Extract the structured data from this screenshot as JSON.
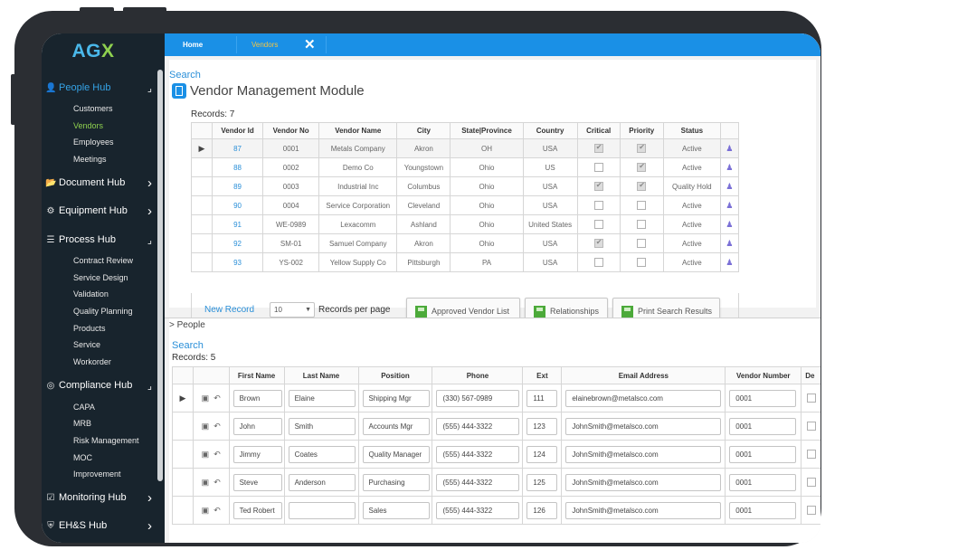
{
  "logo": {
    "a": "AG",
    "x": "X"
  },
  "sidebar": {
    "hubs": [
      {
        "label": "People Hub",
        "icon": "person-icon",
        "glyph": "👤",
        "arrow": "⌟",
        "active": true,
        "items": [
          "Customers",
          "Vendors",
          "Employees",
          "Meetings"
        ]
      },
      {
        "label": "Document Hub",
        "icon": "folder-icon",
        "glyph": "📂",
        "arrow": "›"
      },
      {
        "label": "Equipment Hub",
        "icon": "gears-icon",
        "glyph": "⚙",
        "arrow": "›"
      },
      {
        "label": "Process Hub",
        "icon": "list-icon",
        "glyph": "☰",
        "arrow": "⌟",
        "items": [
          "Contract Review",
          "Service Design",
          "Validation",
          "Quality Planning",
          "Products",
          "Service",
          "Workorder"
        ]
      },
      {
        "label": "Compliance Hub",
        "icon": "target-icon",
        "glyph": "◎",
        "arrow": "⌟",
        "items": [
          "CAPA",
          "MRB",
          "Risk Management",
          "MOC",
          "Improvement"
        ]
      },
      {
        "label": "Monitoring Hub",
        "icon": "checkbox-icon",
        "glyph": "☑",
        "arrow": "›"
      },
      {
        "label": "EH&S Hub",
        "icon": "shield-plus-icon",
        "glyph": "⛨",
        "arrow": "›"
      }
    ],
    "active_item": "Vendors"
  },
  "topbar": {
    "tabs": [
      "Home",
      "Vendors"
    ],
    "close_glyph": "✕"
  },
  "vendor": {
    "search_label": "Search",
    "title": "Vendor Management Module",
    "records": "Records:  7",
    "columns": [
      "Vendor Id",
      "Vendor No",
      "Vendor Name",
      "City",
      "State|Province",
      "Country",
      "Critical",
      "Priority",
      "Status"
    ],
    "rows": [
      {
        "id": "87",
        "no": "0001",
        "name": "Metals Company",
        "city": "Akron",
        "state": "OH",
        "country": "USA",
        "critical": true,
        "priority": true,
        "status": "Active"
      },
      {
        "id": "88",
        "no": "0002",
        "name": "Demo Co",
        "city": "Youngstown",
        "state": "Ohio",
        "country": "US",
        "critical": false,
        "priority": true,
        "status": "Active"
      },
      {
        "id": "89",
        "no": "0003",
        "name": "Industrial Inc",
        "city": "Columbus",
        "state": "Ohio",
        "country": "USA",
        "critical": true,
        "priority": true,
        "status": "Quality Hold"
      },
      {
        "id": "90",
        "no": "0004",
        "name": "Service Corporation",
        "city": "Cleveland",
        "state": "Ohio",
        "country": "USA",
        "critical": false,
        "priority": false,
        "status": "Active"
      },
      {
        "id": "91",
        "no": "WE-0989",
        "name": "Lexacomm",
        "city": "Ashland",
        "state": "Ohio",
        "country": "United States",
        "critical": false,
        "priority": false,
        "status": "Active"
      },
      {
        "id": "92",
        "no": "SM-01",
        "name": "Samuel Company",
        "city": "Akron",
        "state": "Ohio",
        "country": "USA",
        "critical": true,
        "priority": false,
        "status": "Active"
      },
      {
        "id": "93",
        "no": "YS-002",
        "name": "Yellow Supply Co",
        "city": "Pittsburgh",
        "state": "PA",
        "country": "USA",
        "critical": false,
        "priority": false,
        "status": "Active"
      }
    ],
    "new_record": "New Record",
    "per_page_value": "10",
    "per_page_label": "Records per page",
    "buttons": [
      "Approved Vendor List",
      "Relationships",
      "Print Search Results"
    ]
  },
  "people": {
    "section_label": "> People",
    "search_label": "Search",
    "records": "Records:  5",
    "columns": [
      "First Name",
      "Last Name",
      "Position",
      "Phone",
      "Ext",
      "Email Address",
      "Vendor Number",
      "De"
    ],
    "rows": [
      {
        "first": "Brown",
        "last": "Elaine",
        "position": "Shipping Mgr",
        "phone": "(330) 567-0989",
        "ext": "111",
        "email": "elainebrown@metalsco.com",
        "vendor": "0001"
      },
      {
        "first": "John",
        "last": "Smith",
        "position": "Accounts Mgr",
        "phone": "(555) 444-3322",
        "ext": "123",
        "email": "JohnSmith@metalsco.com",
        "vendor": "0001"
      },
      {
        "first": "Jimmy",
        "last": "Coates",
        "position": "Quality Manager",
        "phone": "(555) 444-3322",
        "ext": "124",
        "email": "JohnSmith@metalsco.com",
        "vendor": "0001"
      },
      {
        "first": "Steve",
        "last": "Anderson",
        "position": "Purchasing",
        "phone": "(555) 444-3322",
        "ext": "125",
        "email": "JohnSmith@metalsco.com",
        "vendor": "0001"
      },
      {
        "first": "Ted Robert",
        "last": "",
        "position": "Sales",
        "phone": "(555) 444-3322",
        "ext": "126",
        "email": "JohnSmith@metalsco.com",
        "vendor": "0001"
      }
    ]
  },
  "colors": {
    "accent": "#1a90e6",
    "sidebar": "#18242d",
    "active": "#8fd14f",
    "link": "#2a8fd8"
  }
}
